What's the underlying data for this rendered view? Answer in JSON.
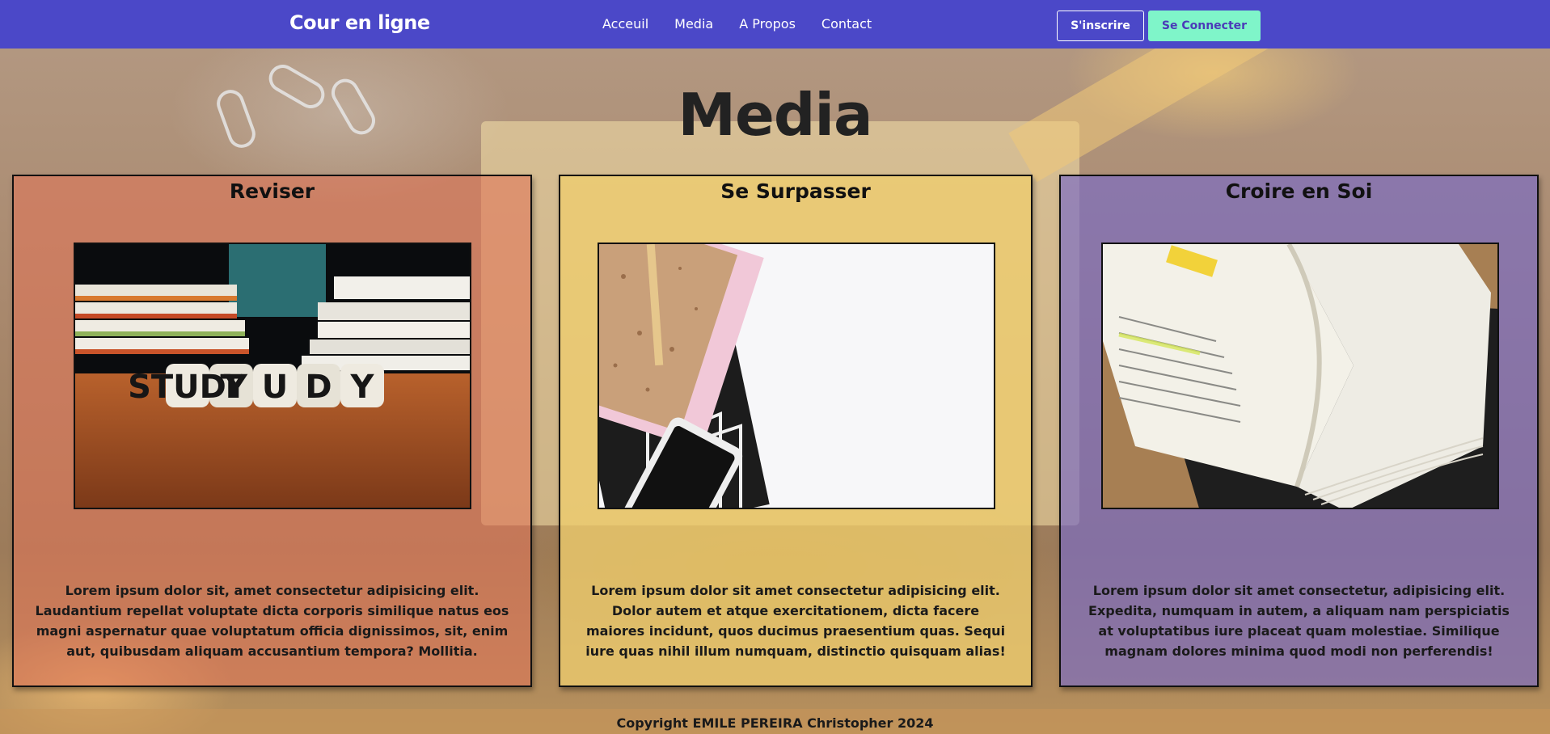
{
  "nav": {
    "brand": "Cour en ligne",
    "links": [
      "Acceuil",
      "Media",
      "A Propos",
      "Contact"
    ],
    "signup_label": "S'inscrire",
    "login_label": "Se Connecter"
  },
  "page": {
    "title": "Media"
  },
  "cards": [
    {
      "title": "Reviser",
      "image_text": "STUDY",
      "text": "Lorem ipsum dolor sit, amet consectetur adipisicing elit. Laudantium repellat voluptate dicta corporis similique natus eos magni aspernatur quae voluptatum officia dignissimos, sit, enim aut, quibusdam aliquam accusantium tempora? Mollitia."
    },
    {
      "title": "Se Surpasser",
      "text": "Lorem ipsum dolor sit amet consectetur adipisicing elit. Dolor autem et atque exercitationem, dicta facere maiores incidunt, quos ducimus praesentium quas. Sequi iure quas nihil illum numquam, distinctio quisquam alias!"
    },
    {
      "title": "Croire en Soi",
      "text": "Lorem ipsum dolor sit amet consectetur, adipisicing elit. Expedita, numquam in autem, a aliquam nam perspiciatis at voluptatibus iure placeat quam molestiae. Similique magnam dolores minima quod modi non perferendis!"
    }
  ],
  "footer": {
    "text": "Copyright EMILE PEREIRA Christopher 2024"
  },
  "colors": {
    "nav": "#4b48c8",
    "login_button": "#7ff5c9",
    "card_1": "#e27658",
    "card_2": "#eecd6e",
    "card_3": "#7a6cc4"
  }
}
